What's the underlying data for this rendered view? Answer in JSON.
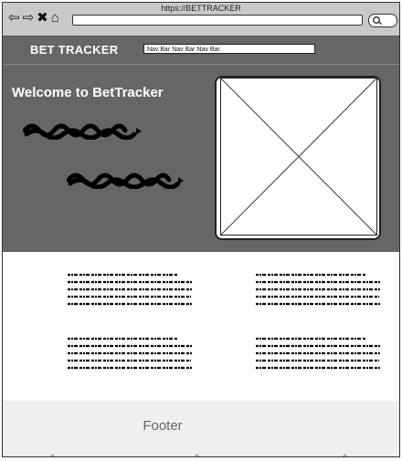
{
  "browser": {
    "url": "https://BETTRACKER",
    "icons": [
      "back-arrow-icon",
      "forward-arrow-icon",
      "close-icon",
      "home-icon",
      "search-icon"
    ]
  },
  "header": {
    "brand": "BET TRACKER",
    "nav_text": "Nav Bar Nav Bar Nav Bar"
  },
  "hero": {
    "title": "Welcome to BetTracker"
  },
  "footer": {
    "label": "Footer"
  }
}
